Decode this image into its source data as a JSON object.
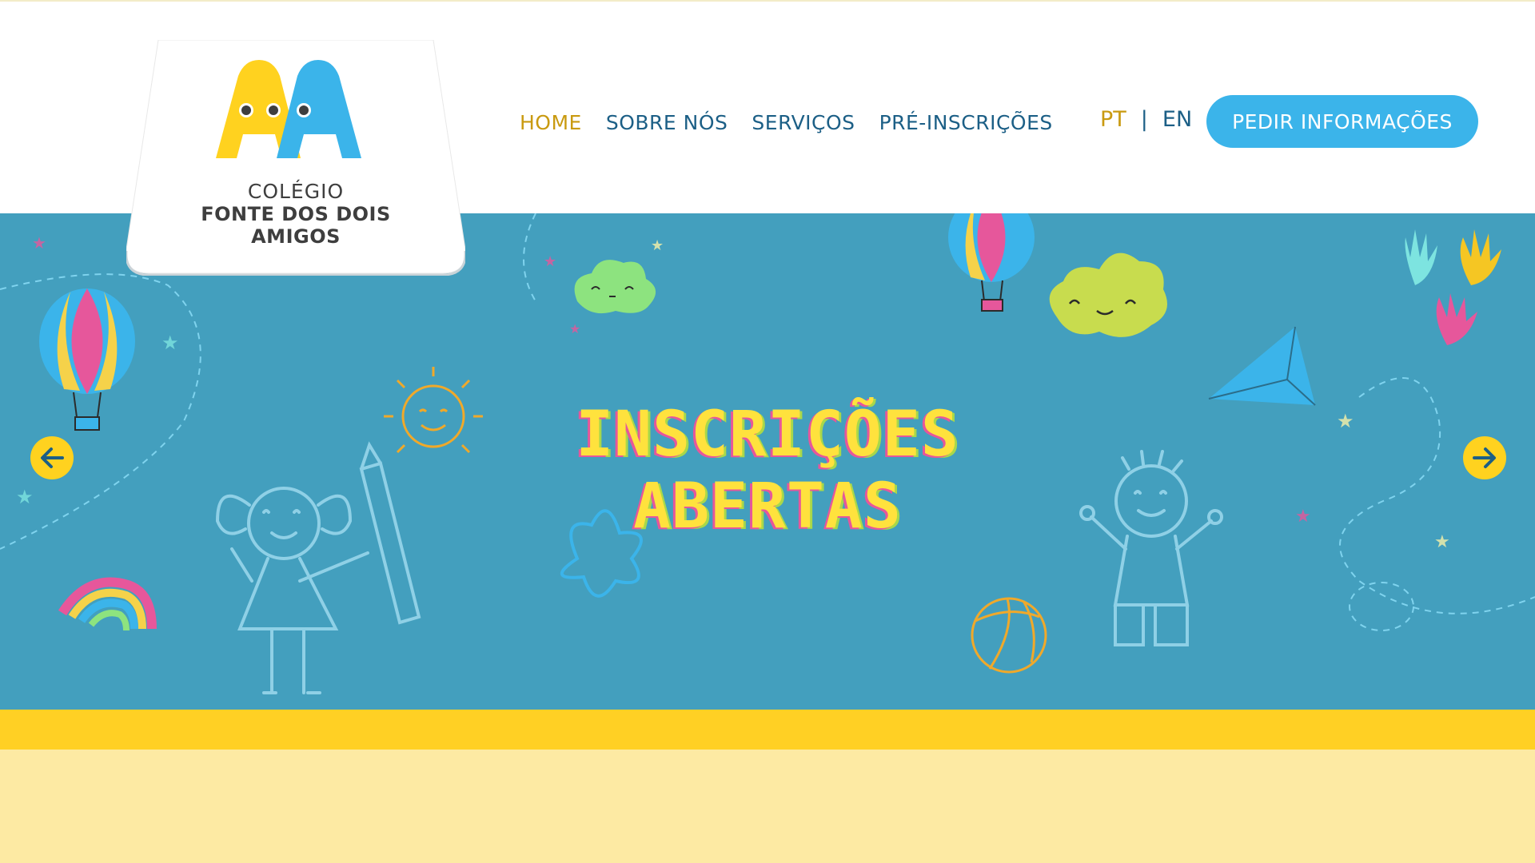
{
  "logo": {
    "line1": "COLÉGIO",
    "line2": "FONTE DOS DOIS",
    "line3": "AMIGOS",
    "colors": {
      "yellow": "#ffd21f",
      "blue": "#3bb4ea"
    }
  },
  "nav": {
    "items": [
      {
        "label": "HOME",
        "active": true
      },
      {
        "label": "SOBRE NÓS",
        "active": false
      },
      {
        "label": "SERVIÇOS",
        "active": false
      },
      {
        "label": "PRÉ-INSCRIÇÕES",
        "active": false
      }
    ]
  },
  "lang": {
    "pt": "PT",
    "separator": "|",
    "en": "EN",
    "active": "PT"
  },
  "cta": {
    "label": "PEDIR INFORMAÇÕES"
  },
  "hero": {
    "title_line1": "INSCRIÇÕES",
    "title_line2": "ABERTAS",
    "background": "#439fbe",
    "prev_icon": "arrow-left-icon",
    "next_icon": "arrow-right-icon"
  },
  "colors": {
    "accent_gold": "#c99a10",
    "nav_blue": "#1c5f86",
    "cta_blue": "#3bb4ea",
    "stripe_yellow": "#ffd024",
    "footer_cream": "#fdeaa3"
  }
}
